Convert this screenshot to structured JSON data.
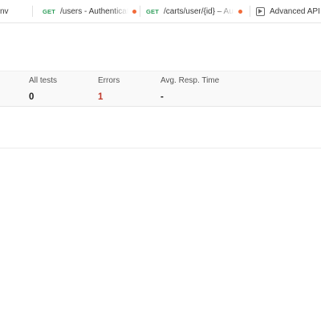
{
  "tabs": [
    {
      "method": "",
      "label": "nv",
      "unsaved": false
    },
    {
      "method": "GET",
      "label": "/users - Authenticated",
      "unsaved": true
    },
    {
      "method": "GET",
      "label": "/carts/user/{id} – Authenticated",
      "unsaved": true
    },
    {
      "method": "",
      "label": "Advanced API Tests",
      "unsaved": false,
      "icon": "play-icon"
    }
  ],
  "summary": {
    "all_tests": {
      "label": "All tests",
      "value": "0"
    },
    "errors": {
      "label": "Errors",
      "value": "1"
    },
    "avg_resp_time": {
      "label": "Avg. Resp. Time",
      "value": "-"
    }
  },
  "colors": {
    "method_get": "#2f9e5b",
    "unsaved_dot": "#f26b3a",
    "error_value": "#c0392b"
  }
}
